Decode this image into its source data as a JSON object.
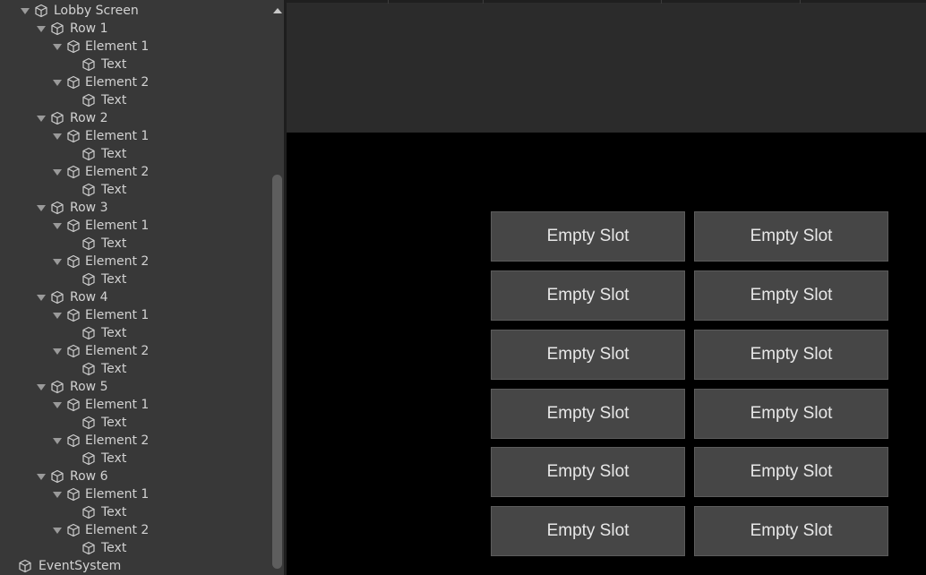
{
  "hierarchy": {
    "items": [
      {
        "label": "Lobby Screen"
      },
      {
        "label": "Row 1"
      },
      {
        "label": "Element 1"
      },
      {
        "label": "Text"
      },
      {
        "label": "Element 2"
      },
      {
        "label": "Text"
      },
      {
        "label": "Row 2"
      },
      {
        "label": "Element 1"
      },
      {
        "label": "Text"
      },
      {
        "label": "Element 2"
      },
      {
        "label": "Text"
      },
      {
        "label": "Row 3"
      },
      {
        "label": "Element 1"
      },
      {
        "label": "Text"
      },
      {
        "label": "Element 2"
      },
      {
        "label": "Text"
      },
      {
        "label": "Row 4"
      },
      {
        "label": "Element 1"
      },
      {
        "label": "Text"
      },
      {
        "label": "Element 2"
      },
      {
        "label": "Text"
      },
      {
        "label": "Row 5"
      },
      {
        "label": "Element 1"
      },
      {
        "label": "Text"
      },
      {
        "label": "Element 2"
      },
      {
        "label": "Text"
      },
      {
        "label": "Row 6"
      },
      {
        "label": "Element 1"
      },
      {
        "label": "Text"
      },
      {
        "label": "Element 2"
      },
      {
        "label": "Text"
      },
      {
        "label": "EventSystem"
      }
    ]
  },
  "game_view": {
    "slots": [
      [
        "Empty Slot",
        "Empty Slot"
      ],
      [
        "Empty Slot",
        "Empty Slot"
      ],
      [
        "Empty Slot",
        "Empty Slot"
      ],
      [
        "Empty Slot",
        "Empty Slot"
      ],
      [
        "Empty Slot",
        "Empty Slot"
      ],
      [
        "Empty Slot",
        "Empty Slot"
      ]
    ]
  },
  "colors": {
    "panel": "#383838",
    "slot": "#464646",
    "text": "#d2d2d2"
  }
}
